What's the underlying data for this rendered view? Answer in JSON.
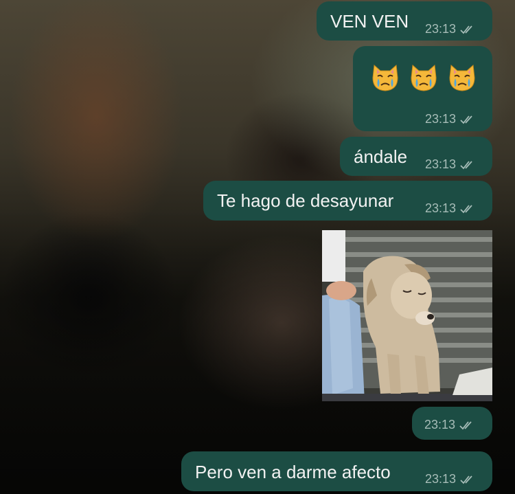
{
  "messages": [
    {
      "kind": "text",
      "text": "VEN VEN",
      "time": "23:13"
    },
    {
      "kind": "emoji",
      "emojis": [
        "crying-cat-face",
        "crying-cat-face",
        "crying-cat-face"
      ],
      "time": "23:13"
    },
    {
      "kind": "text",
      "text": "ándale",
      "time": "23:13"
    },
    {
      "kind": "text",
      "text": "Te hago de desayunar",
      "time": "23:13"
    },
    {
      "kind": "image",
      "content": "dog photo",
      "time": "23:13"
    },
    {
      "kind": "text",
      "text": "Pero ven a darme afecto",
      "time": "23:13"
    }
  ],
  "colors": {
    "bubble": "#1c4d44",
    "timestamp": "#a7bdb8",
    "text": "#f2f2f2"
  }
}
